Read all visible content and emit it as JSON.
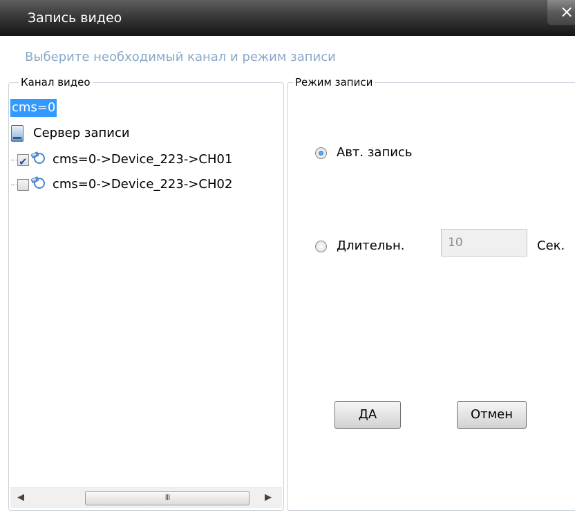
{
  "window": {
    "title": "Запись видео",
    "close_label": "×"
  },
  "instruction": "Выберите необходимый канал и режим записи",
  "channel_group": {
    "legend": "Канал видео",
    "tree": {
      "root": "cms=0",
      "server": "Сервер записи",
      "channels": [
        {
          "label": "cms=0->Device_223->CH01",
          "checked": true
        },
        {
          "label": "cms=0->Device_223->CH02",
          "checked": false
        }
      ]
    },
    "scrollbar": {
      "left_arrow": "◀",
      "right_arrow": "▶",
      "thumb_grip": "III"
    }
  },
  "mode_group": {
    "legend": "Режим записи",
    "auto_label": "Авт. запись",
    "auto_selected": true,
    "duration_label": "Длительн.",
    "duration_selected": false,
    "duration_value": "10",
    "seconds_label": "Сек."
  },
  "buttons": {
    "ok": "ДА",
    "cancel": "Отмен"
  },
  "colors": {
    "selection": "#3399ff",
    "instruction_text": "#8aa8c8",
    "titlebar": "#2a2a2a"
  }
}
